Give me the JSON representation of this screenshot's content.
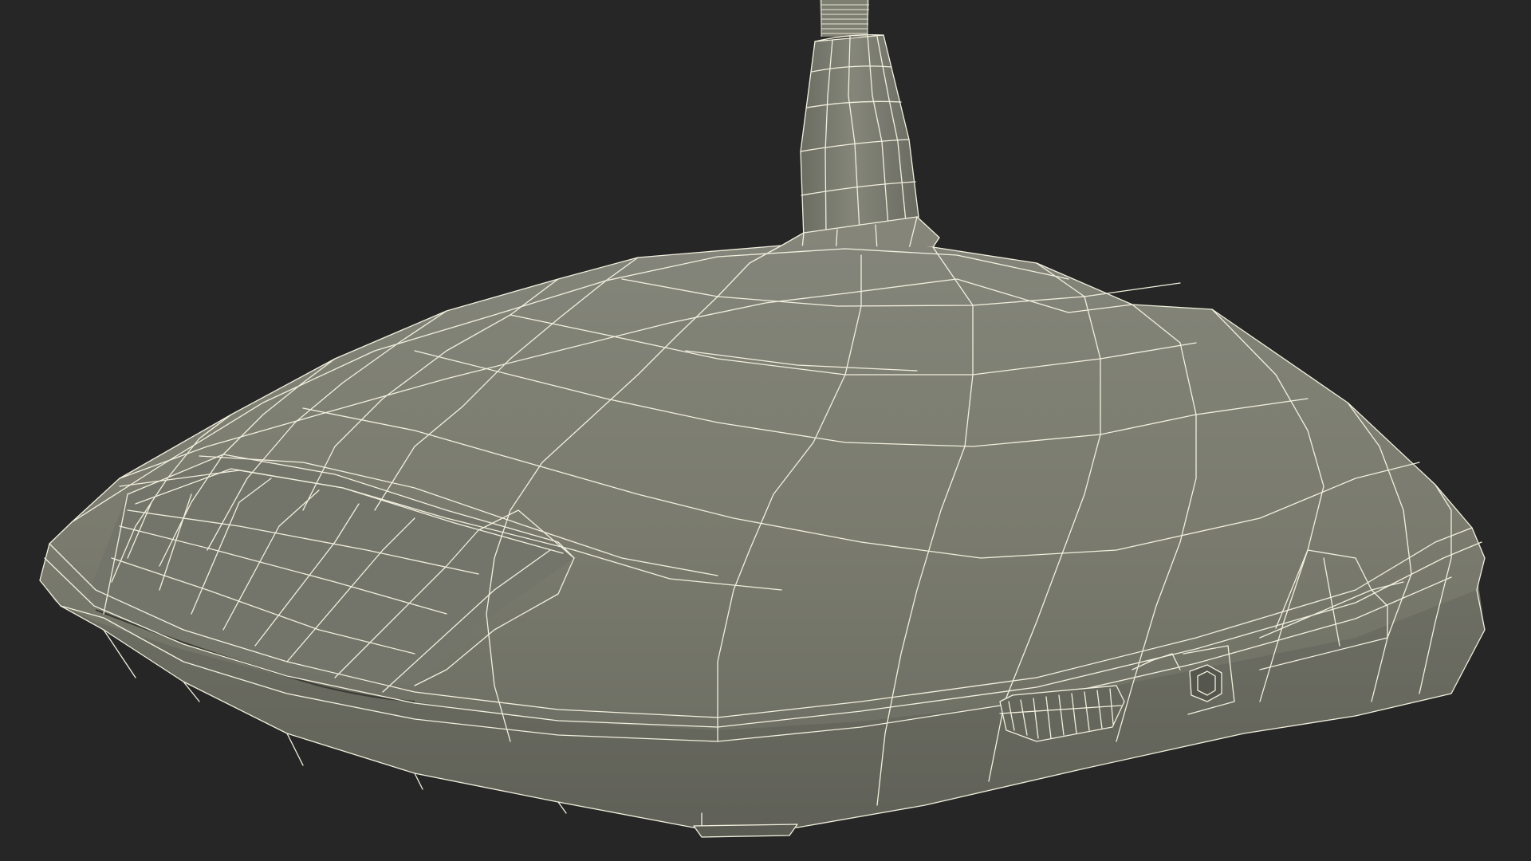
{
  "scene": {
    "subject": "wireframe-microphone-base",
    "background_color": "#262626",
    "surface_color": "#7a7b6e",
    "surface_dark_color": "#6a6b60",
    "wire_color": "#f2f0de"
  }
}
